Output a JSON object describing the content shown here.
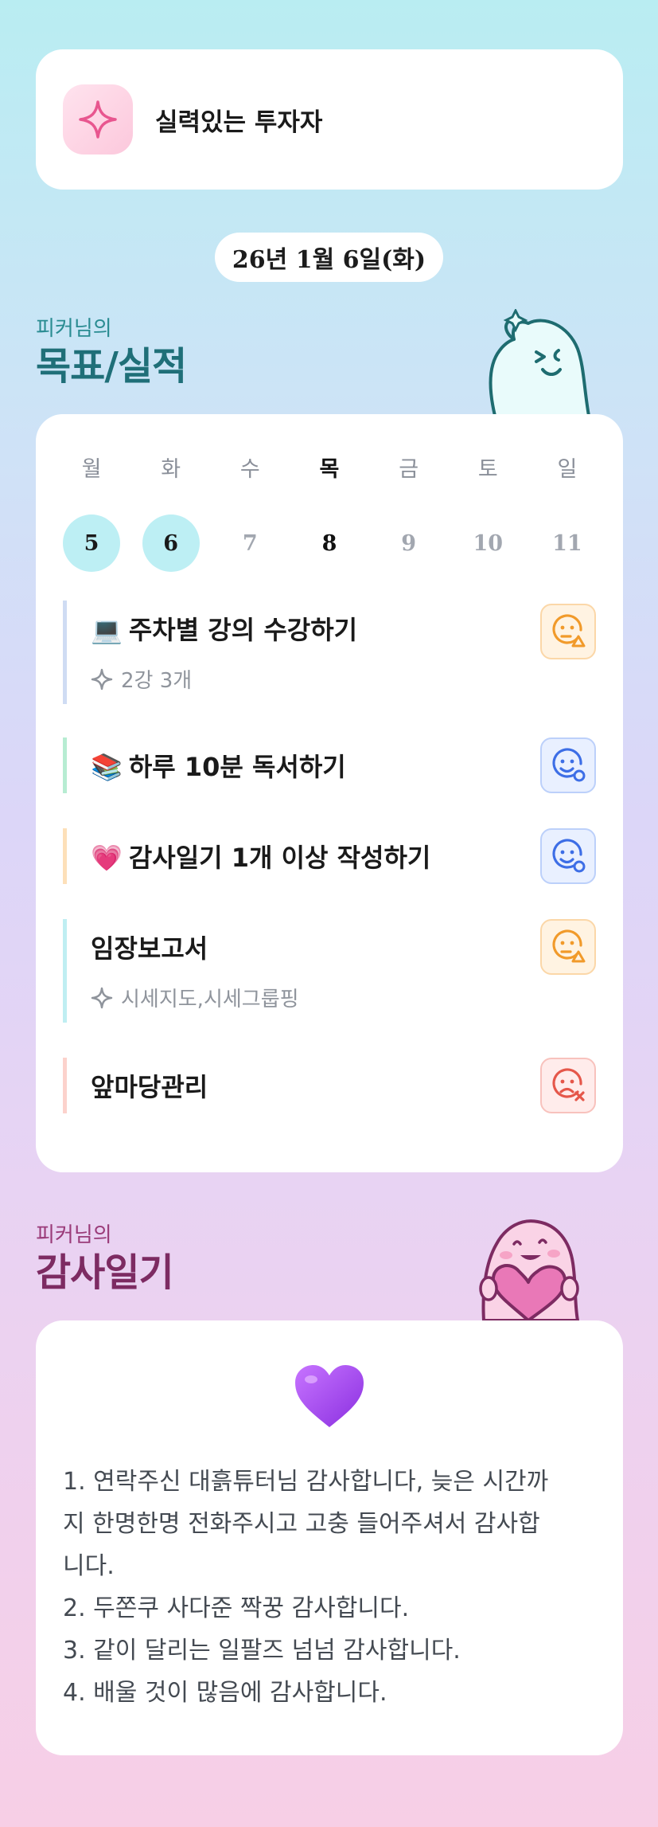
{
  "profile": {
    "name": "실력있는 투자자",
    "icon": "sparkle-icon"
  },
  "date_label": "26년 1월 6일(화)",
  "goals_section": {
    "subtitle": "피커님의",
    "title": "목표/실적"
  },
  "week": {
    "days": [
      {
        "label": "월",
        "date": "5",
        "state": "done"
      },
      {
        "label": "화",
        "date": "6",
        "state": "done"
      },
      {
        "label": "수",
        "date": "7",
        "state": "future"
      },
      {
        "label": "목",
        "date": "8",
        "state": "today"
      },
      {
        "label": "금",
        "date": "9",
        "state": "future"
      },
      {
        "label": "토",
        "date": "10",
        "state": "future"
      },
      {
        "label": "일",
        "date": "11",
        "state": "future"
      }
    ]
  },
  "goals": [
    {
      "emoji": "💻",
      "title": "주차별 강의 수강하기",
      "detail": "2강 3개",
      "status": "warn",
      "status_icon": "neutral-face-warning-icon",
      "bar_color": "#cfdcf3"
    },
    {
      "emoji": "📚",
      "title": "하루 10분 독서하기",
      "detail": "",
      "status": "ok",
      "status_icon": "smile-face-check-icon",
      "bar_color": "#b7ecd2"
    },
    {
      "emoji": "💗",
      "title": "감사일기 1개 이상 작성하기",
      "detail": "",
      "status": "ok",
      "status_icon": "smile-face-check-icon",
      "bar_color": "#fde0b9"
    },
    {
      "emoji": "",
      "title": "임장보고서",
      "detail": "시세지도,시세그룹핑",
      "status": "warn",
      "status_icon": "neutral-face-warning-icon",
      "bar_color": "#bfeef2"
    },
    {
      "emoji": "",
      "title": "앞마당관리",
      "detail": "",
      "status": "bad",
      "status_icon": "sad-face-x-icon",
      "bar_color": "#fcd2cc"
    }
  ],
  "gratitude_section": {
    "subtitle": "피커님의",
    "title": "감사일기"
  },
  "gratitude": {
    "emoji": "💜",
    "lines": [
      "1. 연락주신 대흙튜터님 감사합니다, 늦은 시간까",
      "지 한명한명 전화주시고 고충 들어주셔서 감사합",
      "니다.",
      "2. 두쫀쿠 사다준 짝꿍 감사합니다.",
      "3. 같이 달리는 일팔즈 넘넘 감사합니다.",
      "4. 배울 것이 많음에 감사합니다."
    ]
  },
  "colors": {
    "goal_title": "#1f6f78",
    "gratitude_title": "#7d2b62",
    "done_day": "#bdeff4",
    "warn": "#f19a2a",
    "ok": "#3d6ee6",
    "bad": "#e5574a"
  }
}
